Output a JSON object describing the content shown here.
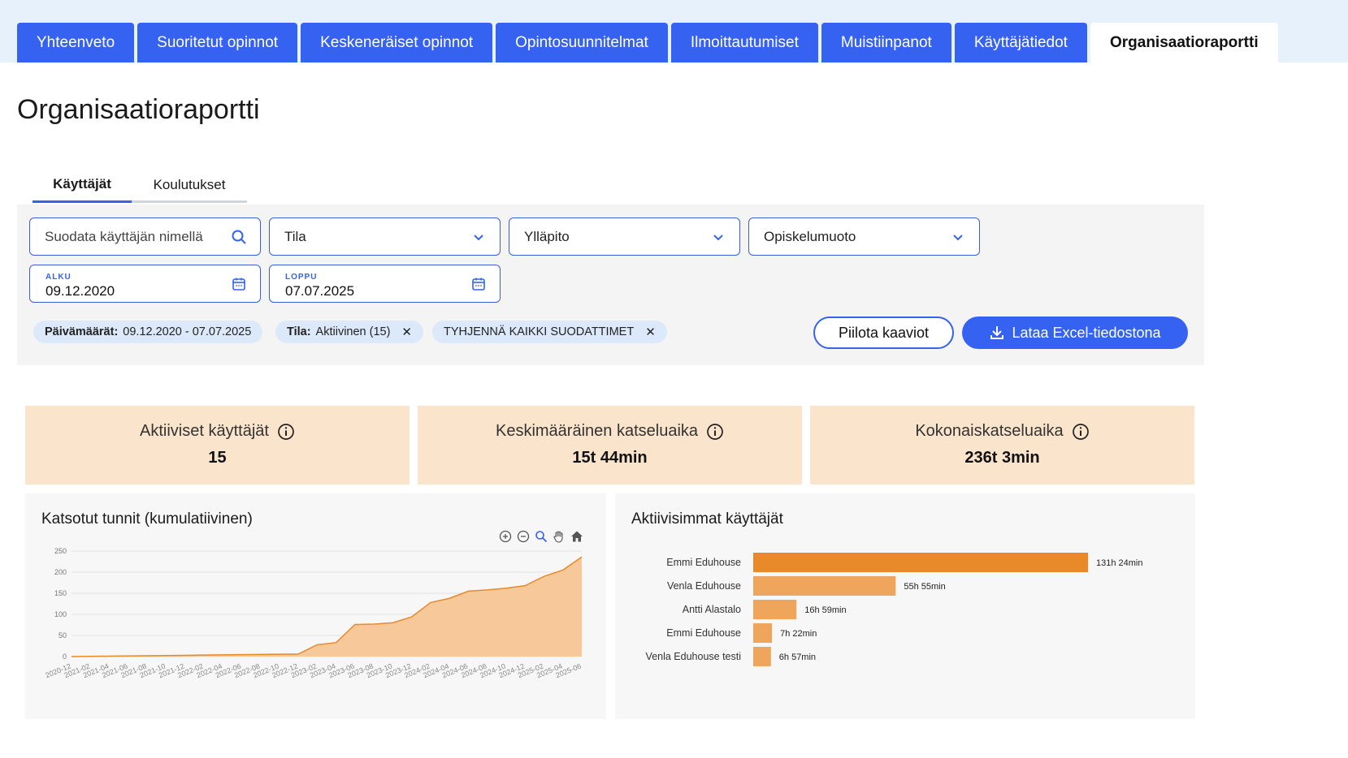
{
  "tabs": [
    {
      "label": "Yhteenveto",
      "active": false
    },
    {
      "label": "Suoritetut opinnot",
      "active": false
    },
    {
      "label": "Keskeneräiset opinnot",
      "active": false
    },
    {
      "label": "Opintosuunnitelmat",
      "active": false
    },
    {
      "label": "Ilmoittautumiset",
      "active": false
    },
    {
      "label": "Muistiinpanot",
      "active": false
    },
    {
      "label": "Käyttäjätiedot",
      "active": false
    },
    {
      "label": "Organisaatioraportti",
      "active": true
    }
  ],
  "page_title": "Organisaatioraportti",
  "subtabs": [
    {
      "label": "Käyttäjät",
      "active": true
    },
    {
      "label": "Koulutukset",
      "active": false
    }
  ],
  "filters": {
    "search_placeholder": "Suodata käyttäjän nimellä",
    "status_select": "Tila",
    "maintainer_select": "Ylläpito",
    "study_mode_select": "Opiskelumuoto",
    "start_label": "ALKU",
    "start_value": "09.12.2020",
    "end_label": "LOPPU",
    "end_value": "07.07.2025"
  },
  "chips": {
    "dates_key": "Päivämäärät:",
    "dates_value": "09.12.2020 - 07.07.2025",
    "status_key": "Tila:",
    "status_value": "Aktiivinen (15)",
    "clear_all": "TYHJENNÄ KAIKKI SUODATTIMET"
  },
  "buttons": {
    "hide_charts": "Piilota kaaviot",
    "download_excel": "Lataa Excel-tiedostona"
  },
  "kpis": [
    {
      "label": "Aktiiviset käyttäjät",
      "value": "15"
    },
    {
      "label": "Keskimääräinen katseluaika",
      "value": "15t 44min"
    },
    {
      "label": "Kokonaiskatseluaika",
      "value": "236t 3min"
    }
  ],
  "colors": {
    "primary": "#3562f0",
    "kpi_bg": "#fbe4cc",
    "area_fill": "#f6c89a",
    "area_line": "#e8892a",
    "bar_main": "#e8892a",
    "bar_light": "#f0a55c"
  },
  "chart_data": [
    {
      "type": "area",
      "title": "Katsotut tunnit (kumulatiivinen)",
      "xlabel": "",
      "ylabel": "",
      "ylim": [
        0,
        250
      ],
      "yticks": [
        0,
        50,
        100,
        150,
        200,
        250
      ],
      "x": [
        "2020-12",
        "2021-02",
        "2021-04",
        "2021-06",
        "2021-08",
        "2021-10",
        "2021-12",
        "2022-02",
        "2022-04",
        "2022-06",
        "2022-08",
        "2022-10",
        "2022-12",
        "2023-02",
        "2023-04",
        "2023-06",
        "2023-08",
        "2023-10",
        "2023-12",
        "2024-02",
        "2024-04",
        "2024-06",
        "2024-08",
        "2024-10",
        "2024-12",
        "2025-02",
        "2025-04",
        "2025-06"
      ],
      "values": [
        0,
        0.5,
        1,
        1.5,
        2,
        2.5,
        3,
        3.5,
        4,
        4.5,
        5,
        5.5,
        6,
        28,
        33,
        76,
        77,
        80,
        94,
        128,
        138,
        155,
        158,
        162,
        168,
        190,
        205,
        236
      ],
      "grid": true,
      "legend": "none"
    },
    {
      "type": "bar",
      "orientation": "horizontal",
      "title": "Aktiivisimmat käyttäjät",
      "categories": [
        "Emmi Eduhouse",
        "Venla Eduhouse",
        "Antti Alastalo",
        "Emmi Eduhouse",
        "Venla Eduhouse testi"
      ],
      "values": [
        131.4,
        55.92,
        16.98,
        7.37,
        6.95
      ],
      "value_labels": [
        "131h 24min",
        "55h 55min",
        "16h 59min",
        "7h 22min",
        "6h 57min"
      ],
      "xlim": [
        0,
        131.4
      ],
      "grid": false,
      "legend": "none"
    }
  ]
}
